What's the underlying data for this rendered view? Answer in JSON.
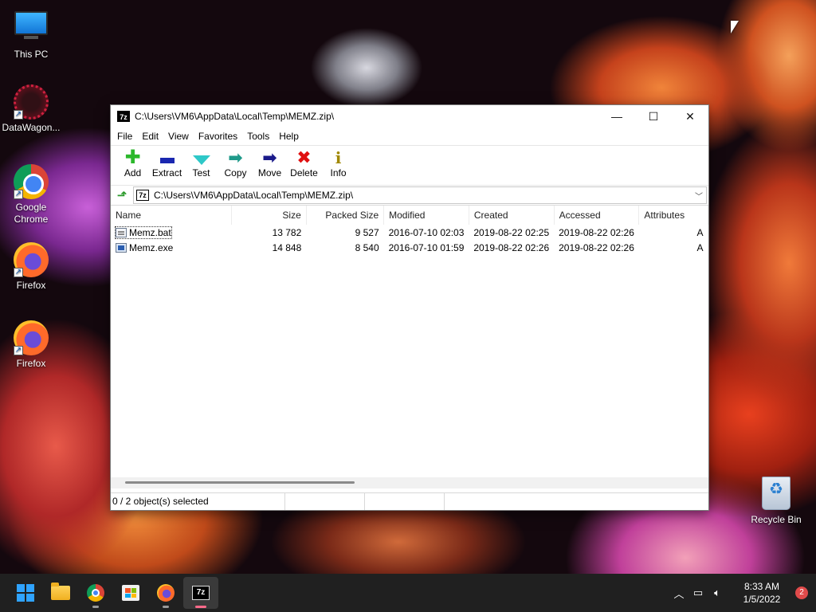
{
  "desktop": {
    "icons": [
      {
        "label": "This PC"
      },
      {
        "label": "DataWagon..."
      },
      {
        "label": "Google Chrome"
      },
      {
        "label": "Firefox"
      },
      {
        "label": "Firefox"
      },
      {
        "label": "Recycle Bin"
      }
    ]
  },
  "window": {
    "title": "C:\\Users\\VM6\\AppData\\Local\\Temp\\MEMZ.zip\\",
    "app_badge": "7z",
    "controls": {
      "minimize": "—",
      "maximize": "☐",
      "close": "✕"
    },
    "menu": [
      "File",
      "Edit",
      "View",
      "Favorites",
      "Tools",
      "Help"
    ],
    "toolbar": [
      {
        "label": "Add",
        "icon": "add-icon"
      },
      {
        "label": "Extract",
        "icon": "extract-icon"
      },
      {
        "label": "Test",
        "icon": "test-icon"
      },
      {
        "label": "Copy",
        "icon": "copy-icon"
      },
      {
        "label": "Move",
        "icon": "move-icon"
      },
      {
        "label": "Delete",
        "icon": "delete-icon"
      },
      {
        "label": "Info",
        "icon": "info-icon"
      }
    ],
    "address": "C:\\Users\\VM6\\AppData\\Local\\Temp\\MEMZ.zip\\",
    "columns": [
      "Name",
      "Size",
      "Packed Size",
      "Modified",
      "Created",
      "Accessed",
      "Attributes"
    ],
    "files": [
      {
        "name": "Memz.bat",
        "size": "13 782",
        "packed": "9 527",
        "modified": "2016-07-10 02:03",
        "created": "2019-08-22 02:25",
        "accessed": "2019-08-22 02:26",
        "attr": "A"
      },
      {
        "name": "Memz.exe",
        "size": "14 848",
        "packed": "8 540",
        "modified": "2016-07-10 01:59",
        "created": "2019-08-22 02:26",
        "accessed": "2019-08-22 02:26",
        "attr": "A"
      }
    ],
    "status": "0 / 2 object(s) selected"
  },
  "taskbar": {
    "apps": [
      "start-button",
      "file-explorer",
      "chrome",
      "microsoft-store",
      "firefox",
      "7-zip"
    ],
    "time": "8:33 AM",
    "date": "1/5/2022",
    "notifications": "2"
  }
}
